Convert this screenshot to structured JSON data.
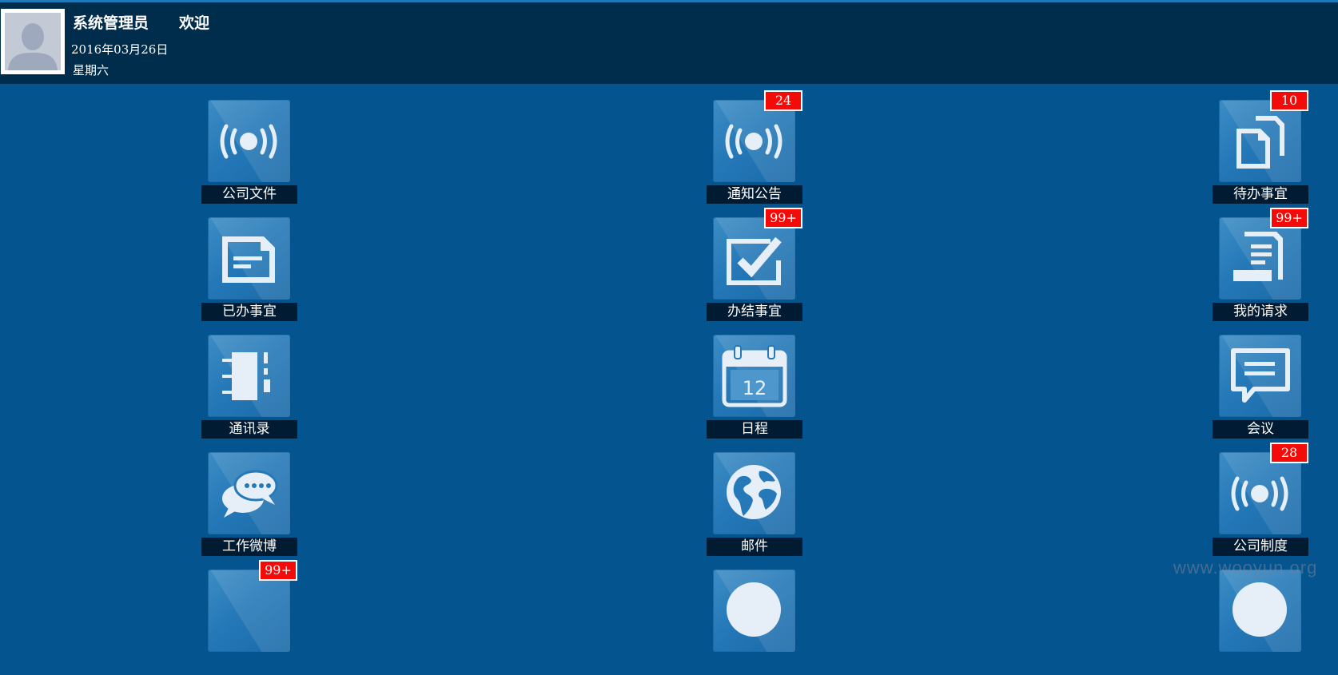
{
  "header": {
    "user_name": "系统管理员",
    "welcome": "欢迎",
    "date": "2016年03月26日",
    "weekday": "星期六"
  },
  "tiles": [
    {
      "label": "公司文件",
      "badge": "",
      "icon": "broadcast-icon"
    },
    {
      "label": "通知公告",
      "badge": "24",
      "icon": "broadcast-icon"
    },
    {
      "label": "待办事宜",
      "badge": "10",
      "icon": "documents-icon"
    },
    {
      "label": "已办事宜",
      "badge": "",
      "icon": "document-icon"
    },
    {
      "label": "办结事宜",
      "badge": "99+",
      "icon": "checkbox-icon"
    },
    {
      "label": "我的请求",
      "badge": "99+",
      "icon": "request-icon"
    },
    {
      "label": "通讯录",
      "badge": "",
      "icon": "address-book-icon"
    },
    {
      "label": "日程",
      "badge": "",
      "icon": "calendar-icon"
    },
    {
      "label": "会议",
      "badge": "",
      "icon": "speech-bubble-icon"
    },
    {
      "label": "工作微博",
      "badge": "",
      "icon": "chat-bubbles-icon"
    },
    {
      "label": "邮件",
      "badge": "",
      "icon": "globe-icon"
    },
    {
      "label": "公司制度",
      "badge": "28",
      "icon": "broadcast-icon"
    },
    {
      "label": "",
      "badge": "99+",
      "icon": "broadcast-icon"
    },
    {
      "label": "",
      "badge": "",
      "icon": "globe-icon"
    },
    {
      "label": "",
      "badge": "",
      "icon": "globe-icon"
    }
  ],
  "calendar_day": "12",
  "watermark": "www.wooyun.org",
  "colors": {
    "background": "#03548f",
    "header": "#012d4d",
    "label_bg": "#011b33",
    "badge": "#f50a0a",
    "tile": "#2579b8"
  }
}
